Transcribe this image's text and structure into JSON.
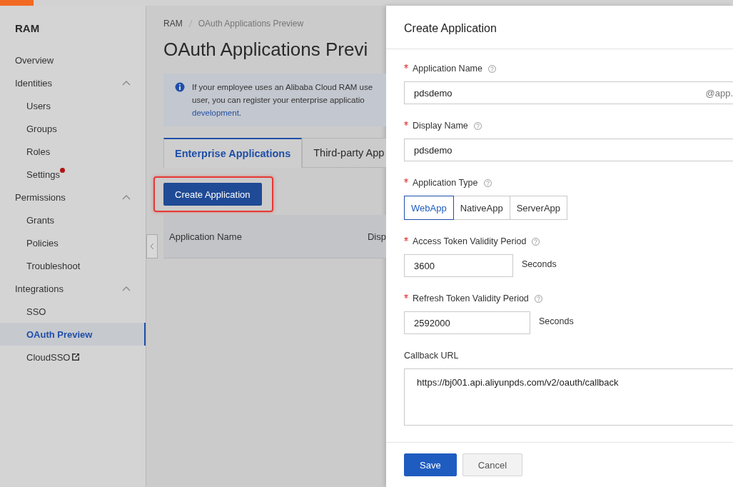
{
  "sidebar": {
    "title": "RAM",
    "items": [
      {
        "label": "Overview",
        "selected": false
      },
      {
        "label": "Identities",
        "expanded": true,
        "children": [
          {
            "label": "Users",
            "selected": false
          },
          {
            "label": "Groups",
            "selected": false
          },
          {
            "label": "Roles",
            "selected": false
          },
          {
            "label": "Settings",
            "selected": false,
            "dot": true
          }
        ]
      },
      {
        "label": "Permissions",
        "expanded": true,
        "children": [
          {
            "label": "Grants",
            "selected": false
          },
          {
            "label": "Policies",
            "selected": false
          },
          {
            "label": "Troubleshoot",
            "selected": false
          }
        ]
      },
      {
        "label": "Integrations",
        "expanded": true,
        "children": [
          {
            "label": "SSO",
            "selected": false
          },
          {
            "label": "OAuth Preview",
            "selected": true
          },
          {
            "label": "CloudSSO",
            "selected": false,
            "external": true
          }
        ]
      }
    ]
  },
  "breadcrumb": [
    "RAM",
    "OAuth Applications Preview"
  ],
  "page_title": "OAuth Applications Previ",
  "info": {
    "lines": [
      "If your employee uses an Alibaba Cloud RAM use",
      "user, you can register your enterprise applicatio"
    ],
    "link": "development",
    "tail": "."
  },
  "tabs": [
    {
      "label": "Enterprise Applications",
      "selected": true
    },
    {
      "label": "Third-party App",
      "selected": false
    }
  ],
  "create_button": "Create Application",
  "table": {
    "columns": [
      "Application Name",
      "Disp"
    ]
  },
  "drawer": {
    "title": "Create Application",
    "fields": [
      {
        "kind": "text",
        "label": "Application Name",
        "required": true,
        "help": true,
        "value": "pdsdemo",
        "suffix": "@app."
      },
      {
        "kind": "text",
        "label": "Display Name",
        "required": true,
        "help": true,
        "value": "pdsdemo"
      },
      {
        "kind": "segmented",
        "label": "Application Type",
        "required": true,
        "help": true,
        "options": [
          {
            "label": "WebApp",
            "selected": true
          },
          {
            "label": "NativeApp",
            "selected": false
          },
          {
            "label": "ServerApp",
            "selected": false
          }
        ]
      },
      {
        "kind": "unit",
        "label": "Access Token Validity Period",
        "required": true,
        "help": true,
        "value": "3600",
        "unit": "Seconds"
      },
      {
        "kind": "unit",
        "label": "Refresh Token Validity Period",
        "required": true,
        "help": true,
        "value": "2592000",
        "unit": "Seconds"
      },
      {
        "kind": "textarea",
        "label": "Callback URL",
        "required": false,
        "help": false,
        "value": "https://bj001.api.aliyunpds.com/v2/oauth/callback"
      }
    ],
    "buttons": [
      {
        "label": "Save",
        "kind": "primary"
      },
      {
        "label": "Cancel",
        "kind": "secondary"
      }
    ]
  }
}
